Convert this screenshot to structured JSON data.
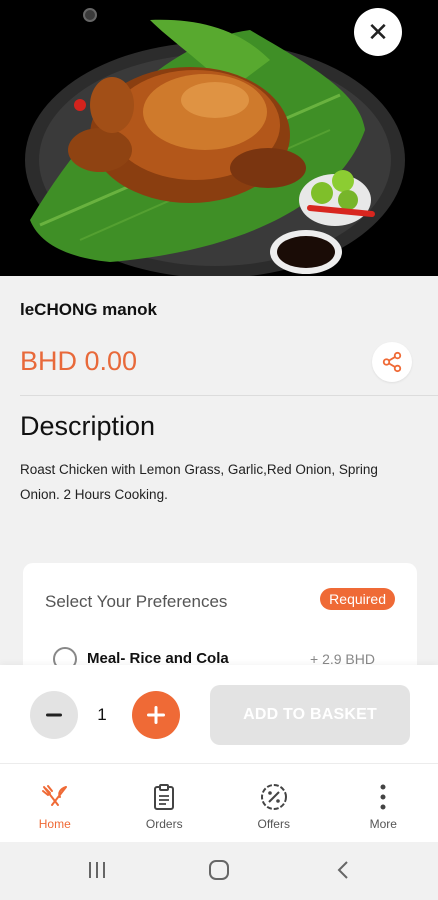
{
  "product": {
    "name": "leCHONG manok",
    "price": "BHD 0.00",
    "image_icon": "roast-chicken-image"
  },
  "description": {
    "heading": "Description",
    "text": "Roast Chicken with Lemon Grass, Garlic,Red Onion, Spring Onion. 2 Hours Cooking."
  },
  "preferences": {
    "title": "Select Your Preferences",
    "badge": "Required",
    "options": [
      {
        "label": "Meal- Rice and Cola",
        "price": "+ 2.9 BHD",
        "selected": false
      }
    ]
  },
  "cart": {
    "quantity": "1",
    "add_label": "ADD TO BASKET"
  },
  "nav": {
    "items": [
      {
        "label": "Home",
        "icon": "fork-knife-icon",
        "active": true
      },
      {
        "label": "Orders",
        "icon": "clipboard-icon",
        "active": false
      },
      {
        "label": "Offers",
        "icon": "percent-badge-icon",
        "active": false
      },
      {
        "label": "More",
        "icon": "more-vertical-icon",
        "active": false
      }
    ]
  },
  "colors": {
    "accent": "#ef6a36",
    "price": "#e8693a",
    "disabled": "#e3e3e3"
  }
}
